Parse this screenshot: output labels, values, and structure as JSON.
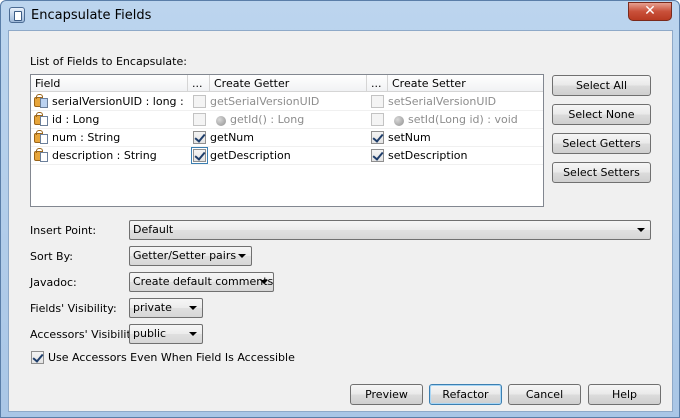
{
  "window": {
    "title": "Encapsulate Fields",
    "close_glyph": "✕"
  },
  "list_label": "List of Fields to Encapsulate:",
  "table": {
    "headers": {
      "field": "Field",
      "getter_dots": "...",
      "getter": "Create Getter",
      "setter_dots": "...",
      "setter": "Create Setter"
    },
    "rows": [
      {
        "field": "serialVersionUID : long : f...",
        "getter": "getSerialVersionUID",
        "setter": "setSerialVersionUID",
        "getter_checked": false,
        "setter_checked": false,
        "disabled": true,
        "icon": "lock-field-icon",
        "getter_dot": false,
        "setter_dot": false
      },
      {
        "field": "id : Long",
        "getter": "getId() : Long",
        "setter": "setId(Long id) : void",
        "getter_checked": false,
        "setter_checked": false,
        "disabled": true,
        "icon": "lock-field-icon",
        "getter_dot": true,
        "setter_dot": true
      },
      {
        "field": "num : String",
        "getter": "getNum",
        "setter": "setNum",
        "getter_checked": true,
        "setter_checked": true,
        "disabled": false,
        "icon": "lock-field-icon",
        "getter_dot": false,
        "setter_dot": false
      },
      {
        "field": "description : String",
        "getter": "getDescription",
        "setter": "setDescription",
        "getter_checked": true,
        "setter_checked": true,
        "disabled": false,
        "icon": "lock-field-icon",
        "getter_dot": false,
        "setter_dot": false
      }
    ]
  },
  "side_buttons": {
    "select_all": "Select All",
    "select_none": "Select None",
    "select_getters": "Select Getters",
    "select_setters": "Select Setters"
  },
  "options": {
    "insert_point": {
      "label": "Insert Point:",
      "value": "Default"
    },
    "sort_by": {
      "label": "Sort By:",
      "value": "Getter/Setter pairs"
    },
    "javadoc": {
      "label": "Javadoc:",
      "value": "Create default comments"
    },
    "fields_visibility": {
      "label": "Fields' Visibility:",
      "value": "private"
    },
    "accessors_visibility": {
      "label": "Accessors' Visibility:",
      "value": "public"
    },
    "use_accessors": {
      "label": "Use Accessors Even When Field Is Accessible",
      "checked": true
    }
  },
  "footer": {
    "preview": "Preview",
    "refactor": "Refactor",
    "cancel": "Cancel",
    "help": "Help"
  }
}
